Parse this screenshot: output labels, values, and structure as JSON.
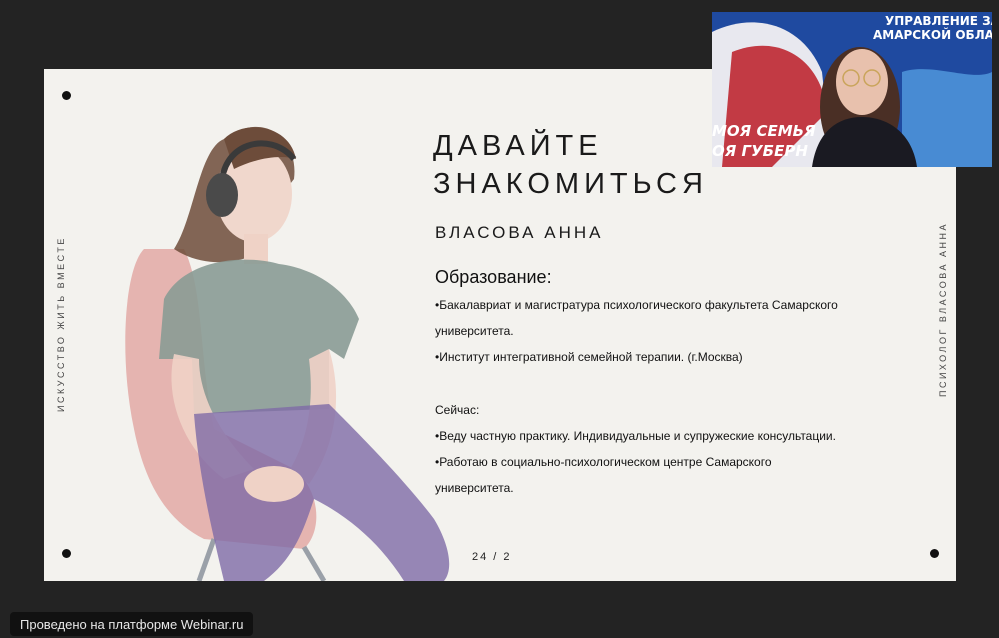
{
  "slide": {
    "title_line1": "ДАВАЙТЕ",
    "title_line2": "ЗНАКОМИТЬСЯ",
    "name": "ВЛАСОВА АННА",
    "side_left": "ИСКУССТВО ЖИТЬ ВМЕСТЕ",
    "side_right": "ПСИХОЛОГ ВЛАСОВА АННА",
    "education_heading": "Образование:",
    "lines": [
      "•Бакалавриат и магистратура психологического факультета Самарского",
      "университета.",
      "•Институт интегративной семейной терапии. (г.Москва)",
      "Сейчас:",
      "•Веду частную практику. Индивидуальные и супружеские консультации.",
      "•Работаю в социально-психологическом центре Самарского",
      "университета."
    ],
    "pager": "24 / 2"
  },
  "webcam": {
    "banner_line1": "УПРАВЛЕНИЕ ЗАГС",
    "banner_line2": "АМАРСКОЙ ОБЛАСТИ",
    "banner_line3": "МОЯ СЕМЬЯ",
    "banner_line4": "ОЯ ГУБЕРН"
  },
  "footer": {
    "platform_label": "Проведено на платформе Webinar.ru"
  },
  "colors": {
    "background": "#232323",
    "slide": "#f3f2ee",
    "shirt": "#8a9b95",
    "pants": "#7e6aa6",
    "chair": "#d9817d",
    "hair": "#6d4c3a"
  },
  "icons": [
    "headphones-icon"
  ]
}
